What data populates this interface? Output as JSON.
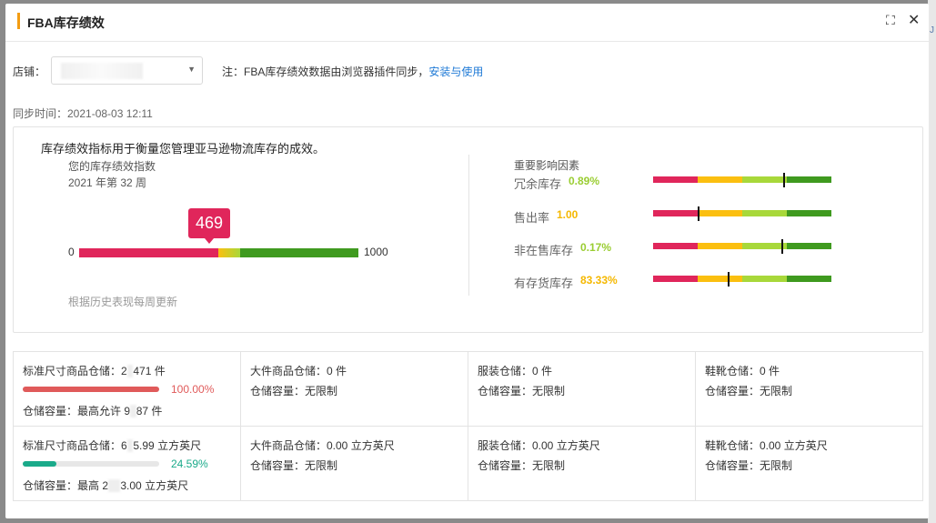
{
  "modal": {
    "title": "FBA库存绩效",
    "expand_icon": "expand-icon",
    "close_icon": "close-icon"
  },
  "store": {
    "label": "店铺：",
    "note_prefix": "注：FBA库存绩效数据由浏览器插件同步，",
    "note_link": "安装与使用"
  },
  "sync": {
    "text": "同步时间：2021-08-03 12:11"
  },
  "performance": {
    "intro": "库存绩效指标用于衡量您管理亚马逊物流库存的成效。",
    "score_label": "您的库存绩效指数",
    "week": "2021 年第 32 周",
    "score": "469",
    "scale_min": "0",
    "scale_max": "1000",
    "update_note": "根据历史表现每周更新",
    "factors_title": "重要影响因素",
    "factors": [
      {
        "name": "冗余库存",
        "value": "0.89%",
        "value_color": "#9acd32",
        "marker": 0.73
      },
      {
        "name": "售出率",
        "value": "1.00",
        "value_color": "#f5b800",
        "marker": 0.25
      },
      {
        "name": "非在售库存",
        "value": "0.17%",
        "value_color": "#9acd32",
        "marker": 0.72
      },
      {
        "name": "有存货库存",
        "value": "83.33%",
        "value_color": "#f5b800",
        "marker": 0.42
      }
    ],
    "colors": {
      "red": "#e0265b",
      "yellow": "#fbbf10",
      "lime": "#a8d83a",
      "green": "#3f9a1f"
    }
  },
  "capacity_units": [
    {
      "title_prefix": "标准尺寸商品仓储：2",
      "title_masked": "7",
      "title_suffix": "471 件",
      "percent": "100.00%",
      "percent_value": 1.0,
      "bar_color": "#e05a5a",
      "cap_prefix": "仓储容量：最高允许 9",
      "cap_masked": "8",
      "cap_suffix": "87 件"
    },
    {
      "title": "大件商品仓储：0 件",
      "cap": "仓储容量：无限制"
    },
    {
      "title": "服装仓储：0 件",
      "cap": "仓储容量：无限制"
    },
    {
      "title": "鞋靴仓储：0 件",
      "cap": "仓储容量：无限制"
    }
  ],
  "capacity_volume": [
    {
      "title_prefix": "标准尺寸商品仓储：6",
      "title_masked": "2",
      "title_suffix": "5.99 立方英尺",
      "percent": "24.59%",
      "percent_value": 0.2459,
      "bar_color": "#1aaa8a",
      "cap_prefix": "仓储容量：最高 2",
      "cap_masked": "56",
      "cap_suffix": "3.00 立方英尺"
    },
    {
      "title": "大件商品仓储：0.00 立方英尺",
      "cap": "仓储容量：无限制"
    },
    {
      "title": "服装仓储：0.00 立方英尺",
      "cap": "仓储容量：无限制"
    },
    {
      "title": "鞋靴仓储：0.00 立方英尺",
      "cap": "仓储容量：无限制"
    }
  ]
}
